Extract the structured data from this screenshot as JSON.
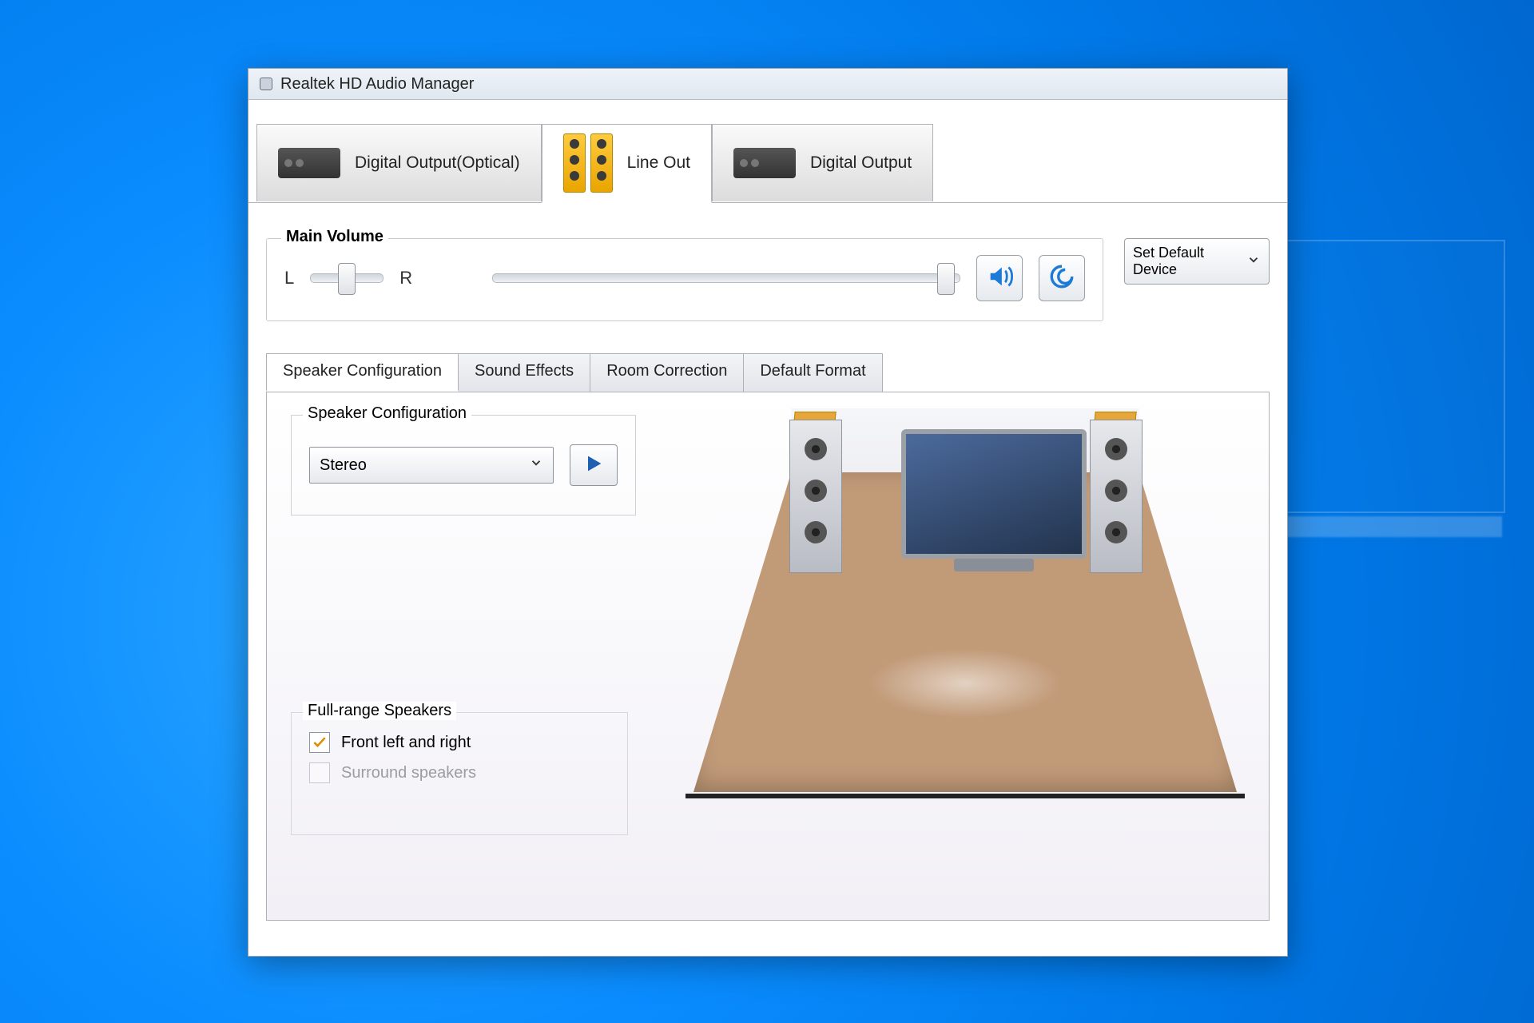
{
  "window": {
    "title": "Realtek HD Audio Manager"
  },
  "device_tabs": [
    {
      "label": "Digital Output(Optical)",
      "active": false
    },
    {
      "label": "Line Out",
      "active": true
    },
    {
      "label": "Digital Output",
      "active": false
    }
  ],
  "main_volume": {
    "section_label": "Main Volume",
    "balance_left_label": "L",
    "balance_right_label": "R",
    "set_default_label": "Set Default Device"
  },
  "secondary_tabs": [
    {
      "label": "Speaker Configuration",
      "active": true
    },
    {
      "label": "Sound Effects",
      "active": false
    },
    {
      "label": "Room Correction",
      "active": false
    },
    {
      "label": "Default Format",
      "active": false
    }
  ],
  "speaker_config": {
    "group_label": "Speaker Configuration",
    "selected": "Stereo"
  },
  "full_range": {
    "group_label": "Full-range Speakers",
    "opt_front": "Front left and right",
    "opt_surround": "Surround speakers"
  }
}
